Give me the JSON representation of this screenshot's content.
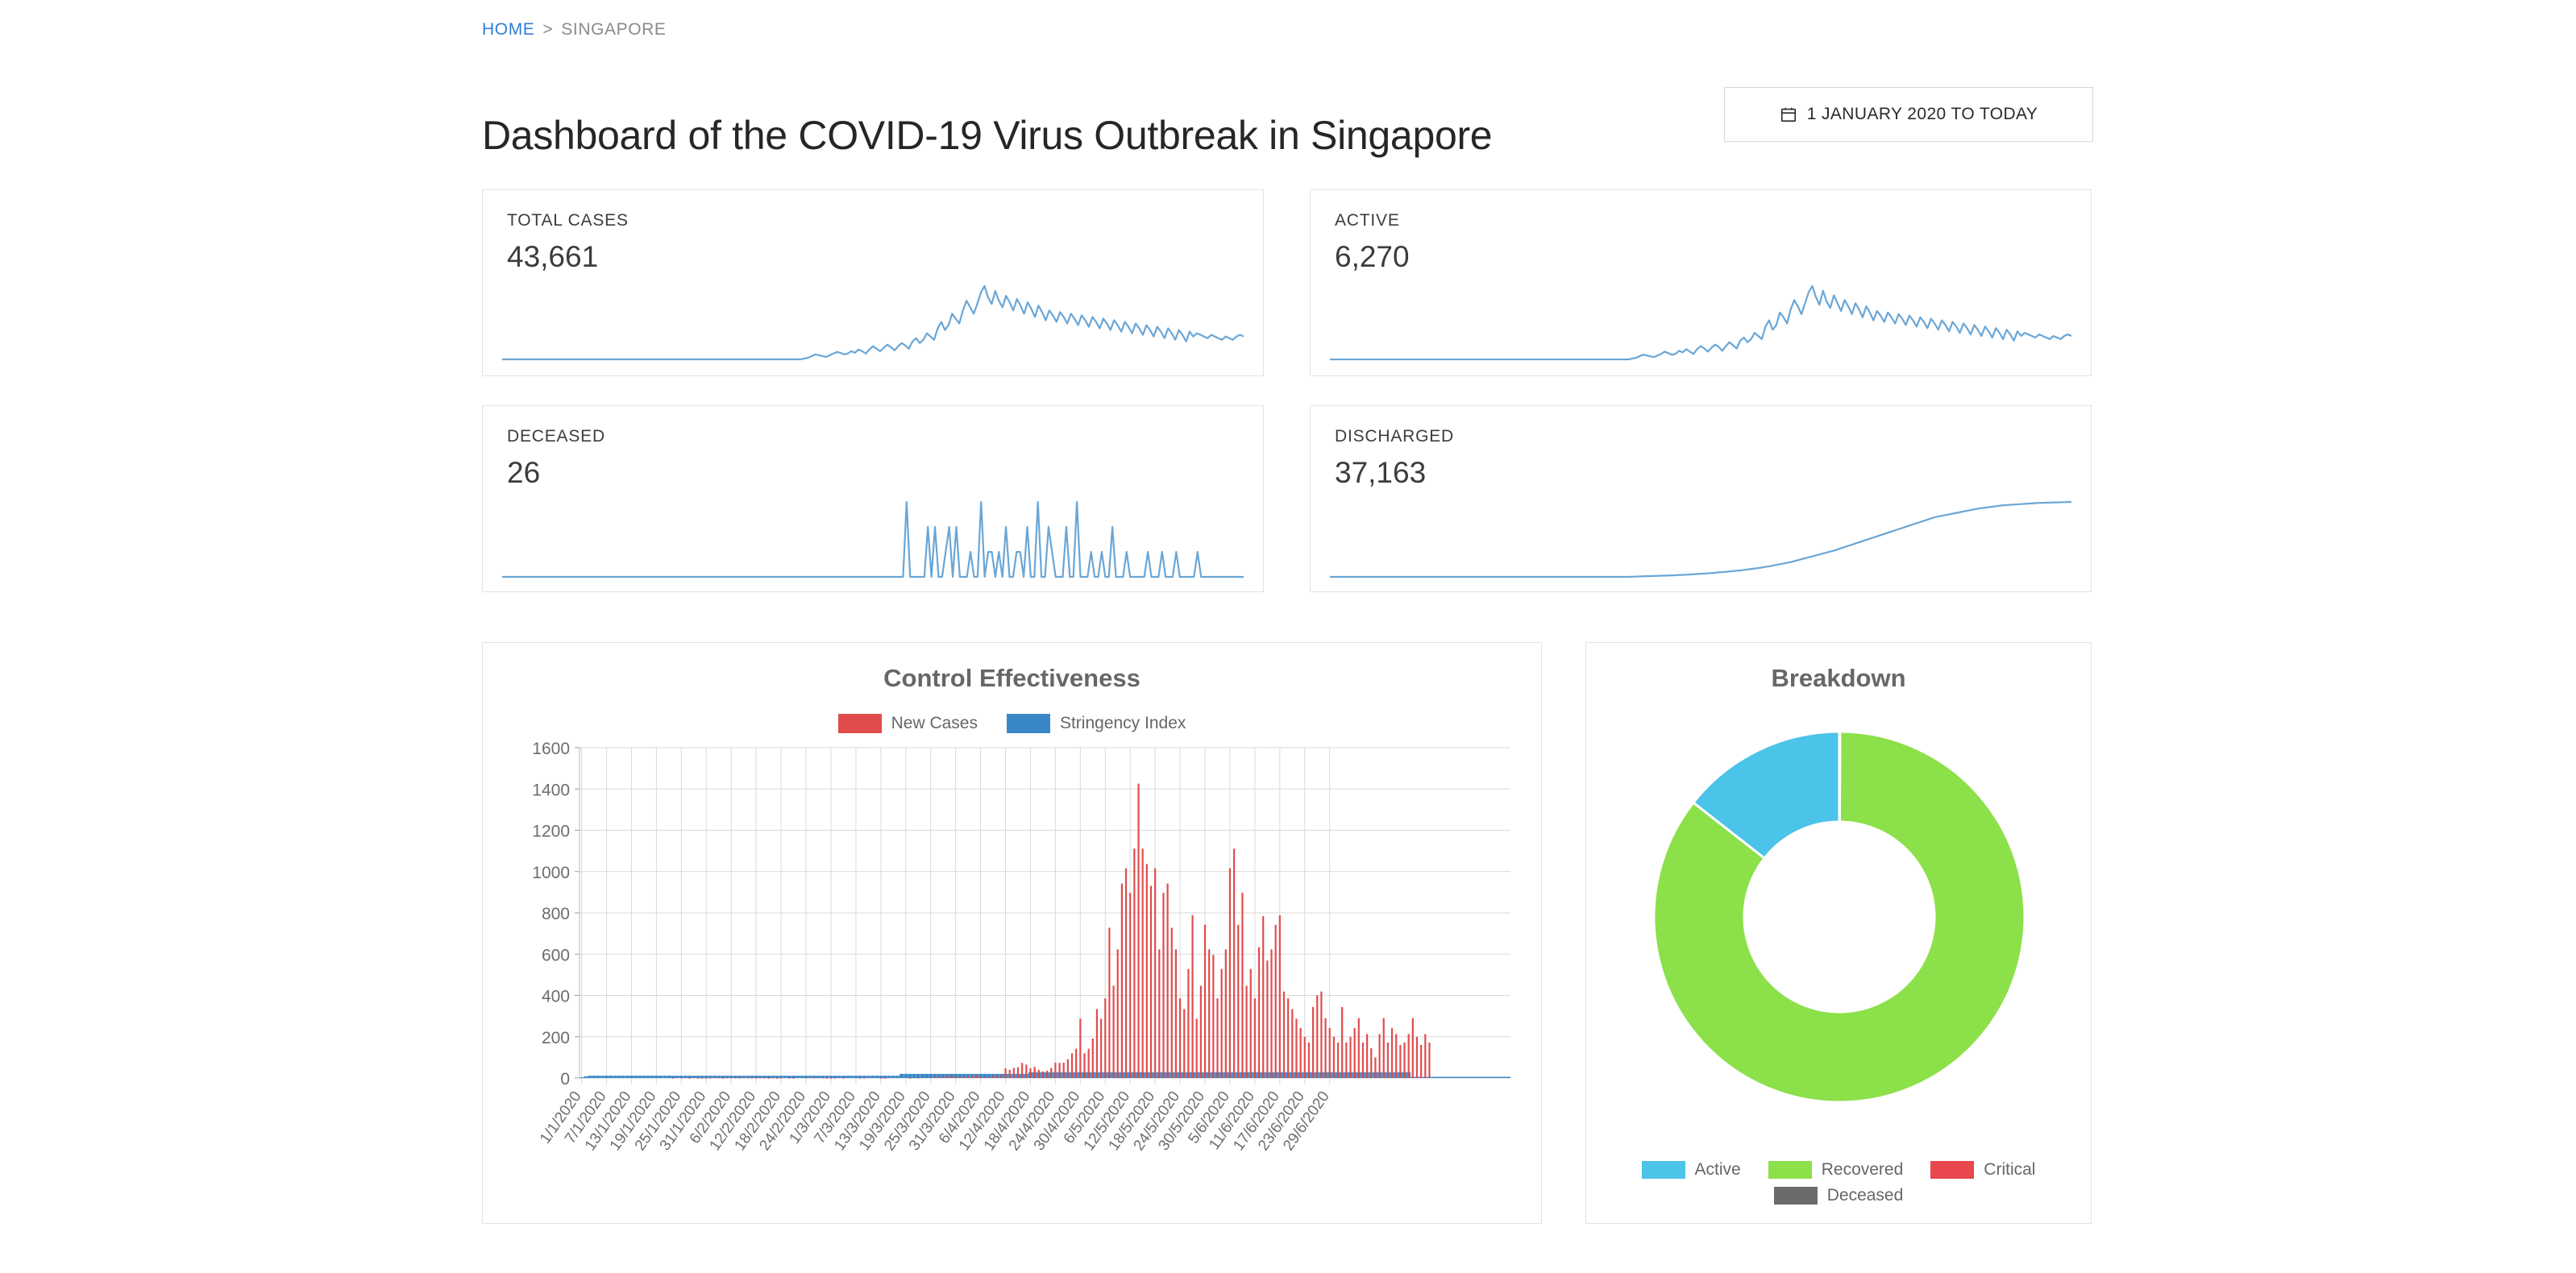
{
  "breadcrumb": {
    "home_label": "HOME",
    "separator": ">",
    "current_label": "SINGAPORE"
  },
  "header": {
    "title": "Dashboard of the COVID-19 Virus Outbreak in Singapore",
    "date_range_label": "1 JANUARY 2020 TO TODAY",
    "calendar_icon": "calendar-icon"
  },
  "stats": [
    {
      "label": "TOTAL CASES",
      "value": "43,661",
      "spark_type": "daily-new-cases"
    },
    {
      "label": "ACTIVE",
      "value": "6,270",
      "spark_type": "active-cases"
    },
    {
      "label": "DECEASED",
      "value": "26",
      "spark_type": "daily-deaths"
    },
    {
      "label": "DISCHARGED",
      "value": "37,163",
      "spark_type": "cumulative-discharged"
    }
  ],
  "colors": {
    "new_cases_red": "#e04b4b",
    "stringency_blue": "#3a87c8",
    "active_blue": "#4cc3e8",
    "recovered_green": "#8ce04a",
    "critical_red": "#e8474d",
    "deceased_gray": "#6b6b6b",
    "sparkline_blue": "#6aa6d6",
    "link_blue": "#2f7ed8",
    "grid_gray": "#d9d9d9"
  },
  "chart_data": [
    {
      "type": "bar",
      "title": "Control Effectiveness",
      "xlabel": "",
      "ylabel": "",
      "ylim": [
        0,
        1600
      ],
      "yticks": [
        0,
        200,
        400,
        600,
        800,
        1000,
        1200,
        1400,
        1600
      ],
      "grid": true,
      "legend_position": "top",
      "legend": [
        "New Cases",
        "Stringency Index"
      ],
      "xtick_labels": [
        "1/1/2020",
        "7/1/2020",
        "13/1/2020",
        "19/1/2020",
        "25/1/2020",
        "31/1/2020",
        "6/2/2020",
        "12/2/2020",
        "18/2/2020",
        "24/2/2020",
        "1/3/2020",
        "7/3/2020",
        "13/3/2020",
        "19/3/2020",
        "25/3/2020",
        "31/3/2020",
        "6/4/2020",
        "12/4/2020",
        "18/4/2020",
        "24/4/2020",
        "30/4/2020",
        "6/5/2020",
        "12/5/2020",
        "18/5/2020",
        "24/5/2020",
        "30/5/2020",
        "5/6/2020",
        "11/6/2020",
        "17/6/2020",
        "23/6/2020",
        "29/6/2020"
      ],
      "xtick_interval_days": 6,
      "series": [
        {
          "name": "New Cases",
          "color": "#e04b4b",
          "values": [
            0,
            0,
            0,
            0,
            0,
            0,
            0,
            0,
            0,
            0,
            0,
            0,
            0,
            0,
            0,
            0,
            0,
            0,
            0,
            0,
            0,
            0,
            1,
            0,
            2,
            0,
            1,
            0,
            1,
            1,
            1,
            2,
            0,
            3,
            1,
            3,
            3,
            2,
            2,
            5,
            3,
            2,
            2,
            3,
            2,
            1,
            3,
            1,
            2,
            0,
            1,
            1,
            0,
            0,
            2,
            0,
            3,
            0,
            2,
            1,
            1,
            1,
            0,
            1,
            0,
            0,
            0,
            1,
            2,
            0,
            0,
            0,
            1,
            1,
            0,
            0,
            0,
            0,
            0,
            1,
            0,
            2,
            0,
            0,
            0,
            9,
            6,
            5,
            13,
            12,
            9,
            5,
            6,
            10,
            14,
            13,
            7,
            5,
            4,
            12,
            9,
            17,
            47,
            40,
            49,
            52,
            73,
            65,
            47,
            54,
            40,
            32,
            35,
            49,
            75,
            73,
            74,
            91,
            120,
            142,
            287,
            120,
            142,
            191,
            334,
            287,
            386,
            728,
            447,
            623,
            942,
            1016,
            897,
            1111,
            1426,
            1111,
            1037,
            931,
            1016,
            623,
            897,
            942,
            728,
            623,
            386,
            334,
            528,
            788,
            287,
            447,
            742,
            623,
            596,
            386,
            528,
            623,
            1016,
            1111,
            742,
            897,
            447,
            528,
            386,
            634,
            784,
            569,
            623,
            742,
            788,
            419,
            386,
            334,
            287,
            242,
            200,
            172,
            344,
            401,
            419,
            290,
            242,
            200,
            172,
            344,
            172,
            200,
            242,
            290,
            172,
            213,
            144,
            100,
            213,
            290,
            172,
            242,
            213,
            160,
            172,
            213,
            290,
            200,
            160,
            213,
            172
          ]
        },
        {
          "name": "Stringency Index",
          "color": "#3a87c8",
          "values": [
            3,
            8,
            11,
            11,
            11,
            11,
            11,
            11,
            11,
            11,
            11,
            11,
            11,
            11,
            11,
            11,
            11,
            11,
            11,
            11,
            11,
            11,
            11,
            11,
            11,
            11,
            11,
            11,
            11,
            11,
            11,
            11,
            11,
            11,
            11,
            11,
            11,
            11,
            11,
            11,
            11,
            11,
            11,
            11,
            11,
            11,
            11,
            11,
            11,
            11,
            11,
            11,
            11,
            11,
            11,
            11,
            11,
            11,
            11,
            11,
            11,
            11,
            11,
            11,
            11,
            11,
            11,
            11,
            11,
            11,
            11,
            11,
            11,
            11,
            11,
            11,
            11,
            20,
            20,
            20,
            20,
            20,
            20,
            20,
            20,
            20,
            20,
            20,
            20,
            20,
            20,
            20,
            20,
            20,
            20,
            20,
            20,
            20,
            20,
            20,
            20,
            20,
            20,
            20,
            20,
            20,
            20,
            20,
            28,
            28,
            28,
            28,
            28,
            28,
            28,
            28,
            28,
            28,
            28,
            28,
            28,
            28,
            28,
            28,
            28,
            28,
            28,
            28,
            28,
            28,
            28,
            28,
            28,
            28,
            28,
            28,
            28,
            28,
            28,
            28,
            28,
            28,
            28,
            28,
            28,
            28,
            28,
            28,
            28,
            28,
            28,
            28,
            28,
            28,
            28,
            28,
            28,
            28,
            28,
            28,
            28,
            28,
            28,
            28,
            28,
            28,
            28,
            28,
            28,
            28,
            28,
            28,
            28,
            28,
            28,
            28,
            28,
            28,
            28,
            28,
            28,
            28,
            28,
            28,
            28,
            28,
            28,
            28,
            28,
            28,
            28,
            28,
            28,
            28,
            28,
            28,
            28,
            28,
            28,
            28,
            6,
            6,
            6,
            6,
            6,
            6,
            6,
            6,
            6,
            6,
            6,
            6,
            6,
            6,
            6,
            6,
            6,
            6,
            6,
            6,
            6,
            6,
            6,
            6
          ]
        }
      ]
    },
    {
      "type": "pie",
      "title": "Breakdown",
      "donut": true,
      "legend_position": "bottom",
      "labels": [
        "Active",
        "Recovered",
        "Critical",
        "Deceased"
      ],
      "values": [
        6270,
        37163,
        0,
        26
      ],
      "percentages": [
        14.4,
        85.1,
        0.0,
        0.1
      ],
      "colors": [
        "#4cc3e8",
        "#8ce04a",
        "#e8474d",
        "#6b6b6b"
      ]
    }
  ],
  "sparkline_data": {
    "daily-new-cases": [
      2,
      2,
      2,
      2,
      2,
      2,
      2,
      2,
      2,
      2,
      2,
      2,
      2,
      2,
      2,
      2,
      2,
      2,
      2,
      2,
      2,
      2,
      2,
      2,
      2,
      2,
      2,
      2,
      2,
      2,
      2,
      2,
      2,
      2,
      2,
      2,
      2,
      2,
      2,
      2,
      2,
      2,
      2,
      2,
      2,
      2,
      2,
      2,
      2,
      2,
      2,
      2,
      2,
      2,
      2,
      2,
      2,
      2,
      2,
      2,
      2,
      2,
      2,
      2,
      2,
      2,
      2,
      2,
      2,
      2,
      2,
      2,
      2,
      2,
      2,
      2,
      2,
      2,
      2,
      2,
      2,
      2,
      2,
      2,
      3,
      4,
      6,
      8,
      7,
      6,
      5,
      7,
      9,
      11,
      10,
      8,
      9,
      12,
      10,
      14,
      12,
      9,
      14,
      18,
      15,
      12,
      16,
      20,
      17,
      13,
      18,
      22,
      19,
      15,
      24,
      28,
      22,
      26,
      34,
      30,
      26,
      40,
      48,
      38,
      44,
      58,
      52,
      46,
      62,
      74,
      66,
      58,
      70,
      84,
      92,
      78,
      70,
      86,
      74,
      66,
      80,
      72,
      62,
      76,
      68,
      58,
      72,
      64,
      54,
      68,
      60,
      50,
      62,
      56,
      48,
      60,
      54,
      46,
      58,
      52,
      44,
      56,
      50,
      42,
      54,
      48,
      40,
      52,
      46,
      38,
      50,
      44,
      36,
      48,
      42,
      34,
      46,
      40,
      32,
      44,
      38,
      30,
      42,
      36,
      28,
      40,
      34,
      26,
      38,
      32,
      24,
      36,
      30,
      34,
      32,
      30,
      28,
      32,
      30,
      28,
      26,
      30,
      28,
      26,
      30,
      32,
      30
    ],
    "active-cases": [
      2,
      2,
      2,
      2,
      2,
      2,
      2,
      2,
      2,
      2,
      2,
      2,
      2,
      2,
      2,
      2,
      2,
      2,
      2,
      2,
      2,
      2,
      2,
      2,
      2,
      2,
      2,
      2,
      2,
      2,
      2,
      2,
      2,
      2,
      2,
      2,
      2,
      2,
      2,
      2,
      2,
      2,
      2,
      2,
      2,
      2,
      2,
      2,
      2,
      2,
      2,
      2,
      2,
      2,
      2,
      2,
      2,
      2,
      2,
      2,
      2,
      2,
      2,
      2,
      2,
      2,
      2,
      2,
      2,
      2,
      2,
      2,
      2,
      2,
      2,
      2,
      2,
      2,
      2,
      2,
      2,
      2,
      2,
      2,
      3,
      4,
      6,
      8,
      7,
      6,
      5,
      7,
      9,
      12,
      10,
      8,
      9,
      13,
      11,
      15,
      12,
      9,
      15,
      19,
      16,
      12,
      17,
      21,
      18,
      13,
      19,
      24,
      20,
      16,
      26,
      30,
      24,
      28,
      36,
      32,
      28,
      44,
      52,
      40,
      46,
      62,
      56,
      48,
      66,
      78,
      70,
      60,
      74,
      88,
      96,
      82,
      72,
      90,
      76,
      68,
      84,
      74,
      64,
      78,
      70,
      60,
      74,
      66,
      56,
      70,
      62,
      52,
      64,
      58,
      50,
      62,
      56,
      48,
      60,
      54,
      46,
      58,
      52,
      44,
      56,
      50,
      42,
      54,
      48,
      40,
      52,
      46,
      38,
      50,
      44,
      36,
      48,
      42,
      34,
      46,
      40,
      32,
      44,
      38,
      30,
      42,
      36,
      28,
      40,
      34,
      26,
      38,
      32,
      36,
      34,
      32,
      30,
      34,
      32,
      30,
      28,
      32,
      30,
      28,
      32,
      34,
      32
    ],
    "daily-deaths": [
      0,
      0,
      0,
      0,
      0,
      0,
      0,
      0,
      0,
      0,
      0,
      0,
      0,
      0,
      0,
      0,
      0,
      0,
      0,
      0,
      0,
      0,
      0,
      0,
      0,
      0,
      0,
      0,
      0,
      0,
      0,
      0,
      0,
      0,
      0,
      0,
      0,
      0,
      0,
      0,
      0,
      0,
      0,
      0,
      0,
      0,
      0,
      0,
      0,
      0,
      0,
      0,
      0,
      0,
      0,
      0,
      0,
      0,
      0,
      0,
      0,
      0,
      0,
      0,
      0,
      0,
      0,
      0,
      0,
      0,
      0,
      0,
      0,
      0,
      0,
      0,
      0,
      0,
      0,
      0,
      0,
      0,
      0,
      0,
      0,
      0,
      0,
      0,
      0,
      0,
      0,
      0,
      0,
      0,
      0,
      0,
      0,
      0,
      0,
      0,
      0,
      0,
      0,
      0,
      0,
      0,
      0,
      0,
      0,
      0,
      0,
      0,
      0,
      0,
      3,
      0,
      0,
      0,
      0,
      0,
      2,
      0,
      2,
      0,
      0,
      1,
      2,
      0,
      2,
      0,
      0,
      0,
      1,
      0,
      0,
      3,
      0,
      1,
      1,
      0,
      1,
      0,
      2,
      0,
      0,
      1,
      1,
      0,
      2,
      0,
      0,
      3,
      0,
      0,
      2,
      1,
      0,
      0,
      0,
      2,
      0,
      0,
      3,
      0,
      0,
      0,
      1,
      0,
      0,
      1,
      0,
      0,
      2,
      0,
      0,
      0,
      1,
      0,
      0,
      0,
      0,
      0,
      1,
      0,
      0,
      0,
      1,
      0,
      0,
      0,
      1,
      0,
      0,
      0,
      0,
      0,
      1,
      0,
      0,
      0,
      0,
      0,
      0,
      0,
      0,
      0,
      0,
      0,
      0,
      0
    ],
    "cumulative-discharged": [
      0,
      0,
      0,
      0,
      0,
      0,
      0,
      0,
      0,
      0,
      0,
      0,
      0,
      0,
      0,
      0,
      0,
      0,
      0,
      0,
      0,
      0,
      0,
      0,
      0,
      0,
      0,
      0,
      0,
      0,
      0,
      0,
      0,
      0,
      0,
      0,
      0,
      0,
      0,
      0,
      0,
      0,
      0,
      0,
      0,
      0,
      0,
      0,
      0,
      0,
      0,
      0,
      0,
      0,
      0,
      0,
      0,
      0,
      0,
      0,
      0,
      0,
      0,
      0,
      0,
      0,
      0,
      0,
      0,
      0,
      0,
      0,
      0,
      0,
      0,
      0,
      0,
      0,
      0,
      0,
      0,
      0,
      0,
      0,
      1,
      1,
      2,
      2,
      3,
      3,
      4,
      4,
      5,
      5,
      6,
      6,
      7,
      8,
      8,
      9,
      10,
      11,
      12,
      13,
      14,
      15,
      16,
      17,
      19,
      20,
      21,
      23,
      24,
      26,
      27,
      29,
      31,
      33,
      35,
      37,
      39,
      42,
      44,
      47,
      50,
      53,
      56,
      59,
      62,
      66,
      70,
      74,
      78,
      82,
      86,
      90,
      94,
      98,
      102,
      106,
      110,
      115,
      120,
      125,
      130,
      135,
      140,
      145,
      150,
      155,
      160,
      165,
      170,
      175,
      180,
      185,
      190,
      195,
      200,
      205,
      210,
      215,
      220,
      225,
      230,
      235,
      240,
      245,
      250,
      253,
      256,
      259,
      262,
      265,
      268,
      271,
      274,
      277,
      280,
      283,
      286,
      288,
      290,
      292,
      294,
      296,
      298,
      300,
      301,
      302,
      303,
      304,
      305,
      306,
      307,
      308,
      309,
      310,
      310,
      311,
      311,
      312,
      312,
      313,
      313,
      314,
      314
    ]
  }
}
